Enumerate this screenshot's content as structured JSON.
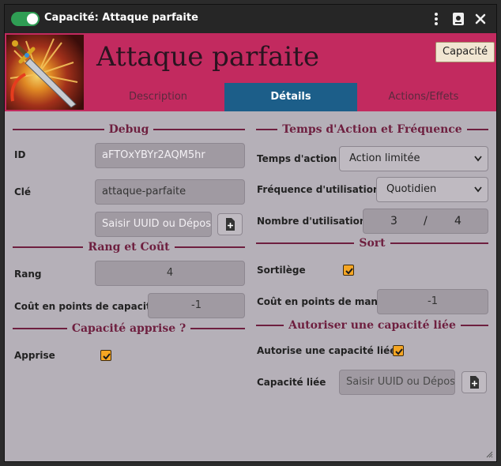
{
  "window": {
    "title": "Capacité: Attaque parfaite",
    "menu_icon": "vertical-dots-icon",
    "sheet_icon": "document-icon",
    "close_icon": "close-icon"
  },
  "header": {
    "name": "Attaque parfaite",
    "type_label": "Capacité",
    "tabs": [
      {
        "label": "Description",
        "active": false
      },
      {
        "label": "Détails",
        "active": true
      },
      {
        "label": "Actions/Effets",
        "active": false
      }
    ]
  },
  "left": {
    "debug": {
      "title": "Debug",
      "id_label": "ID",
      "id_value": "aFTOxYBYr2AQM5hr",
      "key_label": "Clé",
      "key_value": "attaque-parfaite",
      "uuid_placeholder": "Saisir UUID ou Déposer"
    },
    "rank": {
      "title": "Rang et Coût",
      "rank_label": "Rang",
      "rank_value": "4",
      "cost_label": "Coût en points de capacité",
      "cost_value": "-1"
    },
    "learned": {
      "title": "Capacité apprise ?",
      "learned_label": "Apprise",
      "learned_checked": true
    }
  },
  "right": {
    "time": {
      "title": "Temps d'Action et Fréquence",
      "action_time_label": "Temps d'action",
      "action_time_value": "Action limitée",
      "frequency_label": "Fréquence d'utilisation",
      "frequency_value": "Quotidien",
      "uses_label": "Nombre d'utilisation",
      "uses_current": "3",
      "uses_separator": "/",
      "uses_max": "4"
    },
    "spell": {
      "title": "Sort",
      "spell_label": "Sortilège",
      "spell_checked": true,
      "mana_label": "Coût en points de mana",
      "mana_value": "-1"
    },
    "linked": {
      "title": "Autoriser une capacité liée",
      "allow_label": "Autorise une capacité liée",
      "allow_checked": true,
      "linked_label": "Capacité liée",
      "linked_placeholder": "Saisir UUID ou Déposer"
    }
  },
  "colors": {
    "header_bg": "#c22a5f",
    "active_tab": "#1c5e89",
    "panel_bg": "#b5b0b8",
    "section_color": "#6e1f3f",
    "checkbox": "#f5a623",
    "toggle_on": "#2f9e54"
  }
}
